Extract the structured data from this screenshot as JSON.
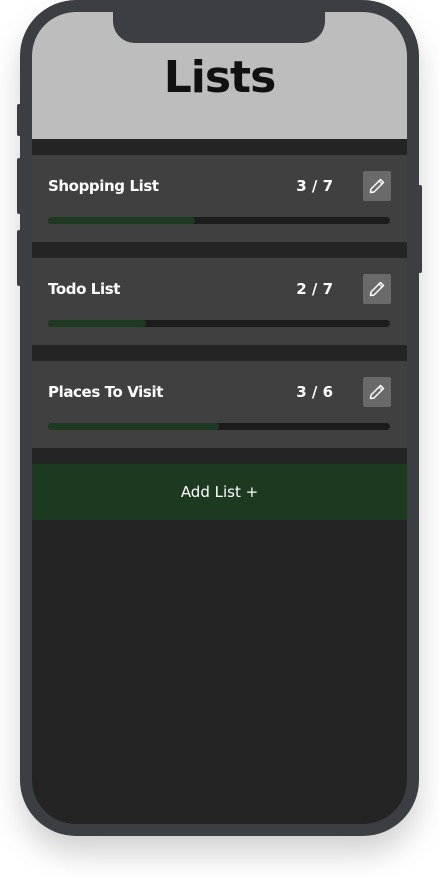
{
  "header": {
    "title": "Lists"
  },
  "lists": [
    {
      "name": "Shopping List",
      "done": 3,
      "total": 7,
      "count_label": "3 / 7",
      "progress": 0.4286
    },
    {
      "name": "Todo List",
      "done": 2,
      "total": 7,
      "count_label": "2 / 7",
      "progress": 0.2857
    },
    {
      "name": "Places To Visit",
      "done": 3,
      "total": 6,
      "count_label": "3 / 6",
      "progress": 0.5
    }
  ],
  "add_button": {
    "label": "Add List +"
  },
  "icons": {
    "edit": "pencil-icon"
  },
  "colors": {
    "header_bg": "#bdbdbd",
    "card_bg": "#404040",
    "screen_bg": "#242424",
    "accent": "#1d3a20",
    "phone_frame": "#3b3e43"
  }
}
